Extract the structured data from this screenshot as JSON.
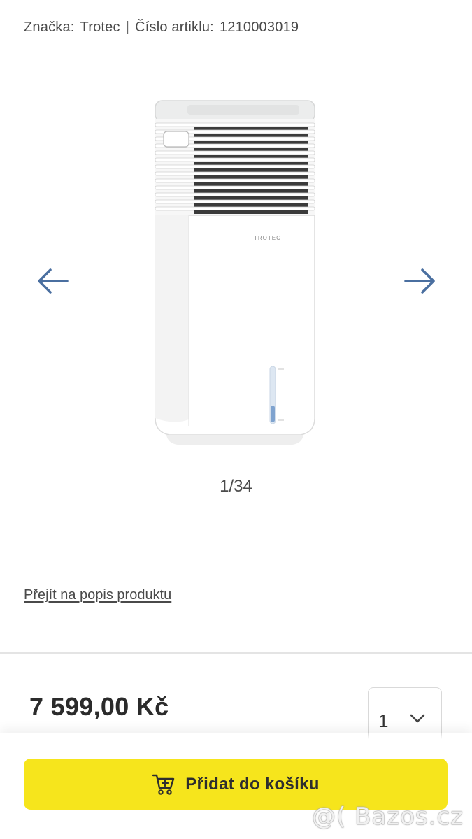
{
  "product_meta": {
    "brand_label": "Značka:",
    "brand_value": "Trotec",
    "separator": "|",
    "article_label": "Číslo artiklu:",
    "article_value": "1210003019"
  },
  "gallery": {
    "counter": "1/34",
    "prev_icon": "arrow-left-icon",
    "next_icon": "arrow-right-icon",
    "image_brand_text": "TROTEC"
  },
  "description_link": "Přejít na popis produktu",
  "price": "7 599,00 Kč",
  "quantity": {
    "value": "1",
    "icon": "chevron-down-icon"
  },
  "cart_button": {
    "label": "Přidat do košíku",
    "icon": "cart-icon",
    "color": "#f6e51c"
  },
  "watermark": "@( Bazos.cz",
  "colors": {
    "arrow": "#4a6fa0",
    "text": "#4a4a4a"
  }
}
